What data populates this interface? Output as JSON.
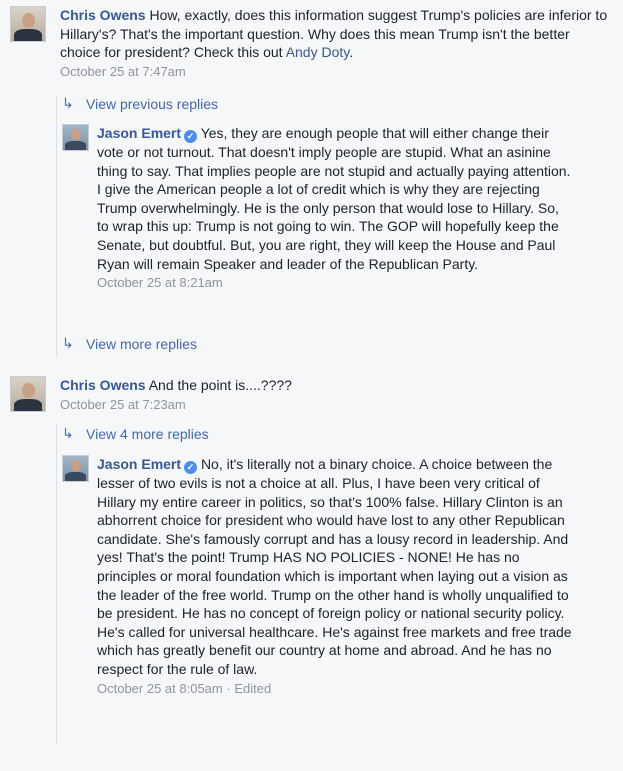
{
  "comments": [
    {
      "author": "Chris Owens",
      "text": "How, exactly, does this information suggest Trump's policies are inferior to Hillary's? That's the important question. Why does this mean Trump isn't the better choice for president? Check this out ",
      "mention": "Andy Doty",
      "text_after": ".",
      "timestamp": "October 25 at 7:47am"
    },
    {
      "author": "Jason Emert",
      "text": "Yes, they are enough people that will either change their vote or not turnout. That doesn't imply people are stupid. What an asinine thing to say. That implies people are not stupid and actually paying attention. I give the American people a lot of credit which is why they are rejecting Trump overwhelmingly. He is the only person that would lose to Hillary. So, to wrap this up: Trump is not going to win. The GOP will hopefully keep the Senate, but doubtful. But, you are right, they will keep the House and Paul Ryan will remain Speaker and leader of the Republican Party.",
      "timestamp": "October 25 at 8:21am"
    },
    {
      "author": "Chris Owens",
      "text": "And the point is....????",
      "timestamp": "October 25 at 7:23am"
    },
    {
      "author": "Jason Emert",
      "text": "No, it's literally not a binary choice. A choice between the lesser of two evils is not a choice at all. Plus, I have been very critical of Hillary my entire career in politics, so that's 100% false. Hillary Clinton is an abhorrent choice for president who would have lost to any other Republican candidate. She's famously corrupt and has a lousy record in leadership. And yes! That's the point! Trump HAS NO POLICIES - NONE! He has no principles or moral foundation which is important when laying out a vision as the leader of the free world. Trump on the other hand is wholly unqualified to be president. He has no concept of foreign policy or national security policy. He's called for universal healthcare. He's against free markets and free trade which has greatly benefit our country at home and abroad. And he has no respect for the rule of law.",
      "timestamp": "October 25 at 8:05am",
      "edited": "Edited"
    }
  ],
  "reply_links": {
    "previous": "View previous replies",
    "more": "View more replies",
    "four_more": "View 4 more replies"
  },
  "icons": {
    "reply_arrow": "reply-arrow-icon",
    "verified": "verified-badge-icon"
  },
  "colors": {
    "link": "#365899",
    "meta": "#90949c",
    "background": "#f6f7f9"
  }
}
